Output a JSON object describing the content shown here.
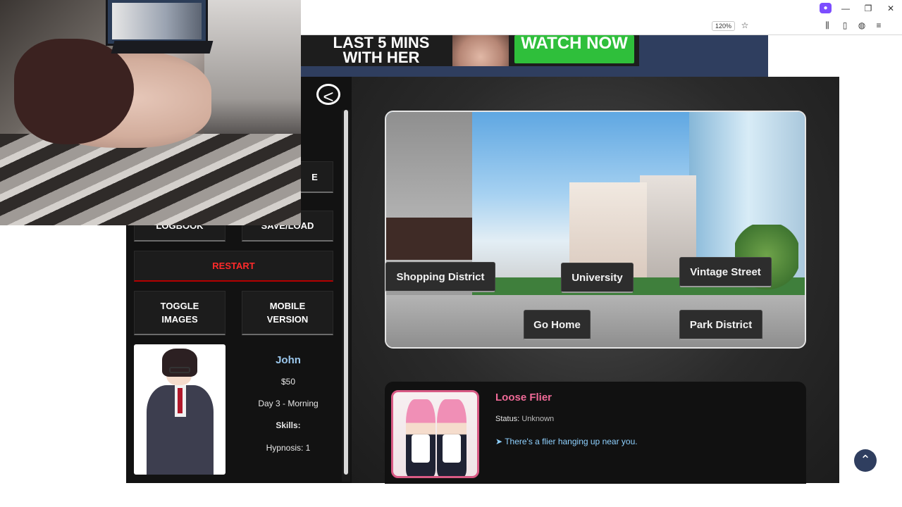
{
  "browser": {
    "zoom": "120%",
    "win_minimize": "—",
    "win_restore": "❐",
    "win_close": "✕"
  },
  "ad": {
    "line1": "LAST 5 MINS",
    "line2": "WITH HER",
    "cta": "WATCH NOW"
  },
  "sidebar": {
    "back_glyph": "<",
    "partial_button": "E",
    "logbook": "LOGBOOK",
    "save_load": "SAVE/LOAD",
    "restart": "RESTART",
    "toggle_images_l1": "TOGGLE",
    "toggle_images_l2": "IMAGES",
    "mobile_version_l1": "MOBILE",
    "mobile_version_l2": "VERSION"
  },
  "character": {
    "name": "John",
    "money": "$50",
    "time": "Day 3 - Morning",
    "skills_label": "Skills:",
    "skill_hypnosis": "Hypnosis: 1"
  },
  "locations": {
    "shopping_district": "Shopping District",
    "university": "University",
    "vintage_street": "Vintage Street",
    "go_home": "Go Home",
    "park_district": "Park District"
  },
  "event": {
    "title": "Loose Flier",
    "status_label": "Status:",
    "status_value": "Unknown",
    "arrow": "➤",
    "description": "There's a flier hanging up near you."
  },
  "colors": {
    "site_blue": "#2f3e5f",
    "restart_red": "#ff2a2a",
    "name_blue": "#9bc7ec",
    "event_pink": "#f06a97",
    "event_desc_blue": "#8fd1ff",
    "ad_green": "#2fbf3b"
  },
  "icons": {
    "back": "back-arrow-icon",
    "scroll_top": "chevron-up-icon"
  }
}
